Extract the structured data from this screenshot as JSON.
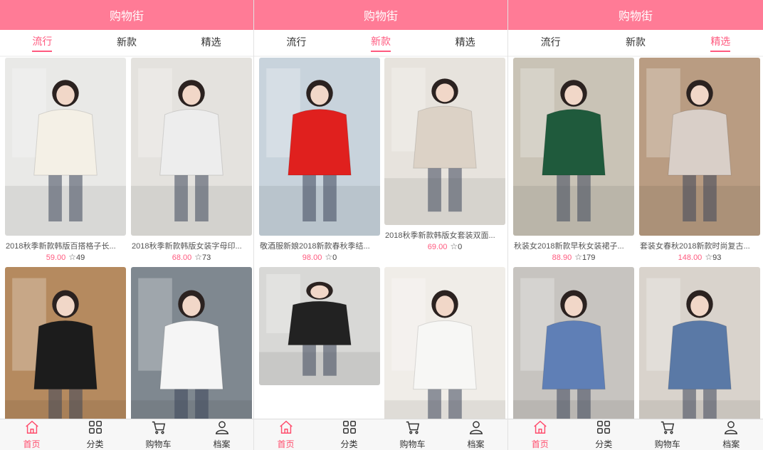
{
  "header_title": "购物街",
  "tabs": [
    "流行",
    "新款",
    "精选"
  ],
  "nav": [
    "首页",
    "分类",
    "购物车",
    "档案"
  ],
  "screens": [
    {
      "active_tab": 0,
      "products": [
        {
          "title": "2018秋季新款韩版百搭格子长...",
          "price": "59.00",
          "fav": "49",
          "bg": "#e9e9e7",
          "fg": "#f4f0e6"
        },
        {
          "title": "2018秋季新款韩版女装字母印...",
          "price": "68.00",
          "fav": "73",
          "bg": "#e4e2de",
          "fg": "#ededed"
        },
        {
          "title": "",
          "price": "",
          "fav": "",
          "bg": "#b58a5f",
          "fg": "#1c1c1c"
        },
        {
          "title": "",
          "price": "",
          "fav": "",
          "bg": "#7f8890",
          "fg": "#f5f5f5"
        }
      ]
    },
    {
      "active_tab": 1,
      "products": [
        {
          "title": "敬酒服新娘2018新款春秋季结...",
          "price": "98.00",
          "fav": "0",
          "bg": "#c8d3dc",
          "fg": "#e0201e"
        },
        {
          "title": "2018秋季新款韩版女套装双面...",
          "price": "69.00",
          "fav": "0",
          "bg": "#e7e3dd",
          "fg": "#dcd2c6"
        },
        {
          "title": "",
          "price": "",
          "fav": "",
          "bg": "#d8d8d6",
          "fg": "#222222"
        },
        {
          "title": "",
          "price": "",
          "fav": "",
          "bg": "#f0ede8",
          "fg": "#f7f7f5"
        }
      ]
    },
    {
      "active_tab": 2,
      "products": [
        {
          "title": "秋装女2018新款早秋女装裙子...",
          "price": "88.90",
          "fav": "179",
          "bg": "#c9c3b6",
          "fg": "#1f5a3c"
        },
        {
          "title": "套装女春秋2018新款时尚复古...",
          "price": "148.00",
          "fav": "93",
          "bg": "#b99c82",
          "fg": "#d9cfc8"
        },
        {
          "title": "",
          "price": "",
          "fav": "",
          "bg": "#c7c4c0",
          "fg": "#5f7fb6"
        },
        {
          "title": "",
          "price": "",
          "fav": "",
          "bg": "#d9d3cc",
          "fg": "#5a79a6"
        }
      ]
    }
  ],
  "colors": {
    "header": "#ff7b96",
    "accent": "#ff5a7f",
    "active_nav": "#ff4d6d"
  },
  "icons": {
    "star": "star-outline-icon",
    "home": "home-icon",
    "category": "grid-icon",
    "cart": "cart-icon",
    "profile": "user-icon"
  }
}
